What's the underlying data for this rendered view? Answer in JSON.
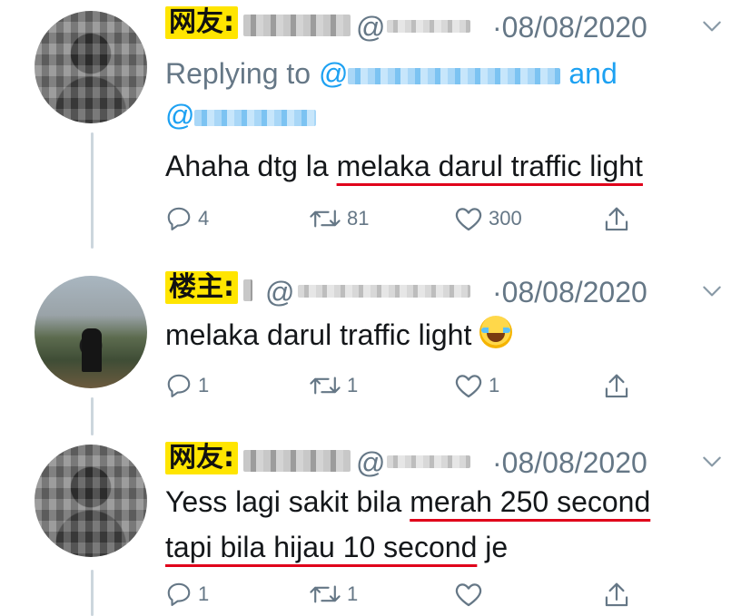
{
  "tweets": [
    {
      "tag": "网友:",
      "at": "@",
      "date": "·08/08/2020",
      "replying_prefix": "Replying to ",
      "replying_at": "@",
      "replying_and": " and",
      "replying_at2": "@",
      "text_plain": "Ahaha dtg la ",
      "text_underlined": "melaka darul traffic light",
      "reply_count": "4",
      "retweet_count": "81",
      "like_count": "300"
    },
    {
      "tag": "楼主:",
      "at": "@",
      "date": "·08/08/2020",
      "text_plain": "melaka darul traffic light ",
      "emoji": "face-with-tears-of-joy",
      "reply_count": "1",
      "retweet_count": "1",
      "like_count": "1"
    },
    {
      "tag": "网友:",
      "at": "@",
      "date": "·08/08/2020",
      "text_line1_plain": "Yess lagi sakit bila ",
      "text_line1_underlined": "merah 250 second",
      "text_line2_underlined": "tapi bila hijau 10 second",
      "text_line2_plain": " je",
      "reply_count": "1",
      "retweet_count": "1",
      "like_count": ""
    }
  ],
  "colors": {
    "accent": "#1da1f2",
    "muted": "#657786",
    "underline": "#e0001a",
    "tag_bg": "#ffe500",
    "thread_line": "#ccd6dd"
  },
  "icons": [
    "reply-icon",
    "retweet-icon",
    "like-icon",
    "share-icon",
    "chevron-down-icon"
  ]
}
